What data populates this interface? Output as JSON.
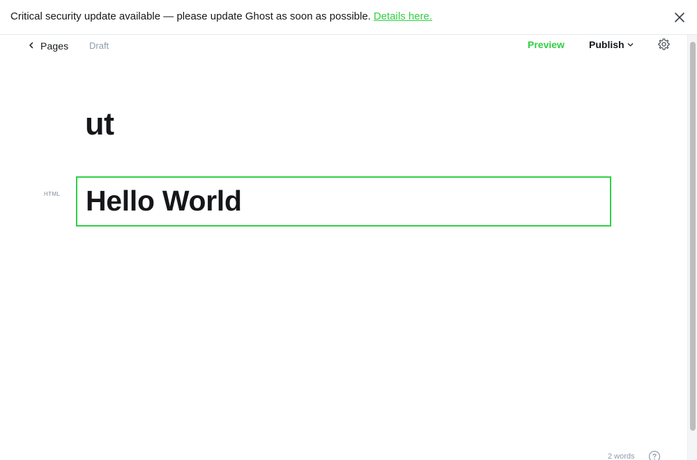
{
  "banner": {
    "message": "Critical security update available — please update Ghost as soon as possible.",
    "link_text": "Details here.",
    "close_icon": "close-icon"
  },
  "header": {
    "back_label": "Pages",
    "back_icon": "chevron-left-icon",
    "status": "Draft",
    "preview_label": "Preview",
    "publish_label": "Publish",
    "publish_icon": "chevron-down-icon",
    "settings_icon": "gear-icon"
  },
  "post": {
    "title": "ut",
    "cards": [
      {
        "type_label": "HTML",
        "content": "Hello World"
      }
    ]
  },
  "footer": {
    "word_count": "2 words",
    "help_icon": "help-icon"
  },
  "colors": {
    "accent": "#30cf43",
    "text": "#15171a",
    "muted": "#8e9cac",
    "border": "#e6e9eb"
  }
}
